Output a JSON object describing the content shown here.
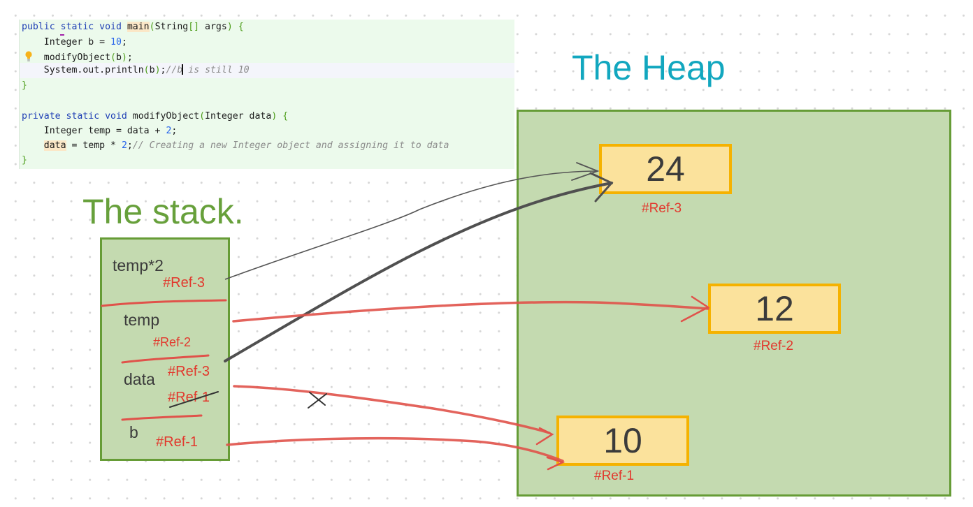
{
  "code": {
    "lines": [
      {
        "parts": [
          {
            "t": "public static void ",
            "c": "kw"
          },
          {
            "t": "main",
            "c": "mark"
          },
          {
            "t": "(",
            "c": "br"
          },
          {
            "t": "String"
          },
          {
            "t": "[]",
            "c": "br"
          },
          {
            "t": " args"
          },
          {
            "t": ")",
            "c": "br"
          },
          {
            "t": " "
          },
          {
            "t": "{",
            "c": "br"
          }
        ]
      },
      {
        "parts": [
          {
            "t": "    Integer b = "
          },
          {
            "t": "10",
            "c": "num"
          },
          {
            "t": ";"
          }
        ]
      },
      {
        "parts": [
          {
            "t": "    modifyObject"
          },
          {
            "t": "(",
            "c": "br"
          },
          {
            "t": "b"
          },
          {
            "t": ")",
            "c": "br"
          },
          {
            "t": ";"
          }
        ]
      },
      {
        "parts": [
          {
            "t": "    System.out.println"
          },
          {
            "t": "(",
            "c": "br"
          },
          {
            "t": "b"
          },
          {
            "t": ")",
            "c": "br"
          },
          {
            "t": ";"
          },
          {
            "t": "//b",
            "c": "cm"
          },
          {
            "t": "",
            "c": "caret"
          },
          {
            "t": " is still 10",
            "c": "cm"
          }
        ],
        "highlight": true
      },
      {
        "parts": [
          {
            "t": "}",
            "c": "br"
          }
        ]
      },
      {
        "parts": []
      },
      {
        "parts": [
          {
            "t": "private static void ",
            "c": "kw"
          },
          {
            "t": "modifyObject"
          },
          {
            "t": "(",
            "c": "br"
          },
          {
            "t": "Integer data"
          },
          {
            "t": ")",
            "c": "br"
          },
          {
            "t": " "
          },
          {
            "t": "{",
            "c": "br"
          }
        ]
      },
      {
        "parts": [
          {
            "t": "    Integer temp = data + "
          },
          {
            "t": "2",
            "c": "num"
          },
          {
            "t": ";"
          }
        ]
      },
      {
        "parts": [
          {
            "t": "    "
          },
          {
            "t": "data",
            "c": "mark"
          },
          {
            "t": " = temp * "
          },
          {
            "t": "2",
            "c": "num"
          },
          {
            "t": ";"
          },
          {
            "t": "// Creating a new Integer object and assigning it to data",
            "c": "cm"
          }
        ]
      },
      {
        "parts": [
          {
            "t": "}",
            "c": "br"
          }
        ]
      }
    ],
    "gutter_icon": "lightbulb-icon"
  },
  "heap": {
    "title": "The Heap",
    "objects": [
      {
        "value": "24",
        "ref": "#Ref-3"
      },
      {
        "value": "12",
        "ref": "#Ref-2"
      },
      {
        "value": "10",
        "ref": "#Ref-1"
      }
    ]
  },
  "stack": {
    "title": "The stack.",
    "frames": [
      {
        "var": "temp*2",
        "ref": "#Ref-3"
      },
      {
        "var": "temp",
        "ref": "#Ref-2"
      },
      {
        "var": "data",
        "ref": "#Ref-3",
        "old_ref": "#Ref-1",
        "old_ref_struck": true
      },
      {
        "var": "b",
        "ref": "#Ref-1"
      }
    ]
  },
  "arrows": [
    {
      "from": "temp*2",
      "to": "#Ref-3",
      "color": "#555555",
      "style": "thin"
    },
    {
      "from": "data",
      "to": "#Ref-3",
      "color": "#505050",
      "style": "thick"
    },
    {
      "from": "temp",
      "to": "#Ref-2",
      "color": "#e0524a",
      "style": "marker"
    },
    {
      "from": "data",
      "to": "#Ref-1",
      "color": "#e0524a",
      "style": "marker",
      "crossed_out": true
    },
    {
      "from": "b",
      "to": "#Ref-1",
      "color": "#e0524a",
      "style": "marker"
    }
  ],
  "colors": {
    "panel_fill": "#c4dab0",
    "panel_border": "#669c36",
    "object_fill": "#fbe29c",
    "object_border": "#f5b200",
    "ref_text": "#e2382d",
    "heap_title": "#12a7bf",
    "stack_title": "#67a03b"
  }
}
